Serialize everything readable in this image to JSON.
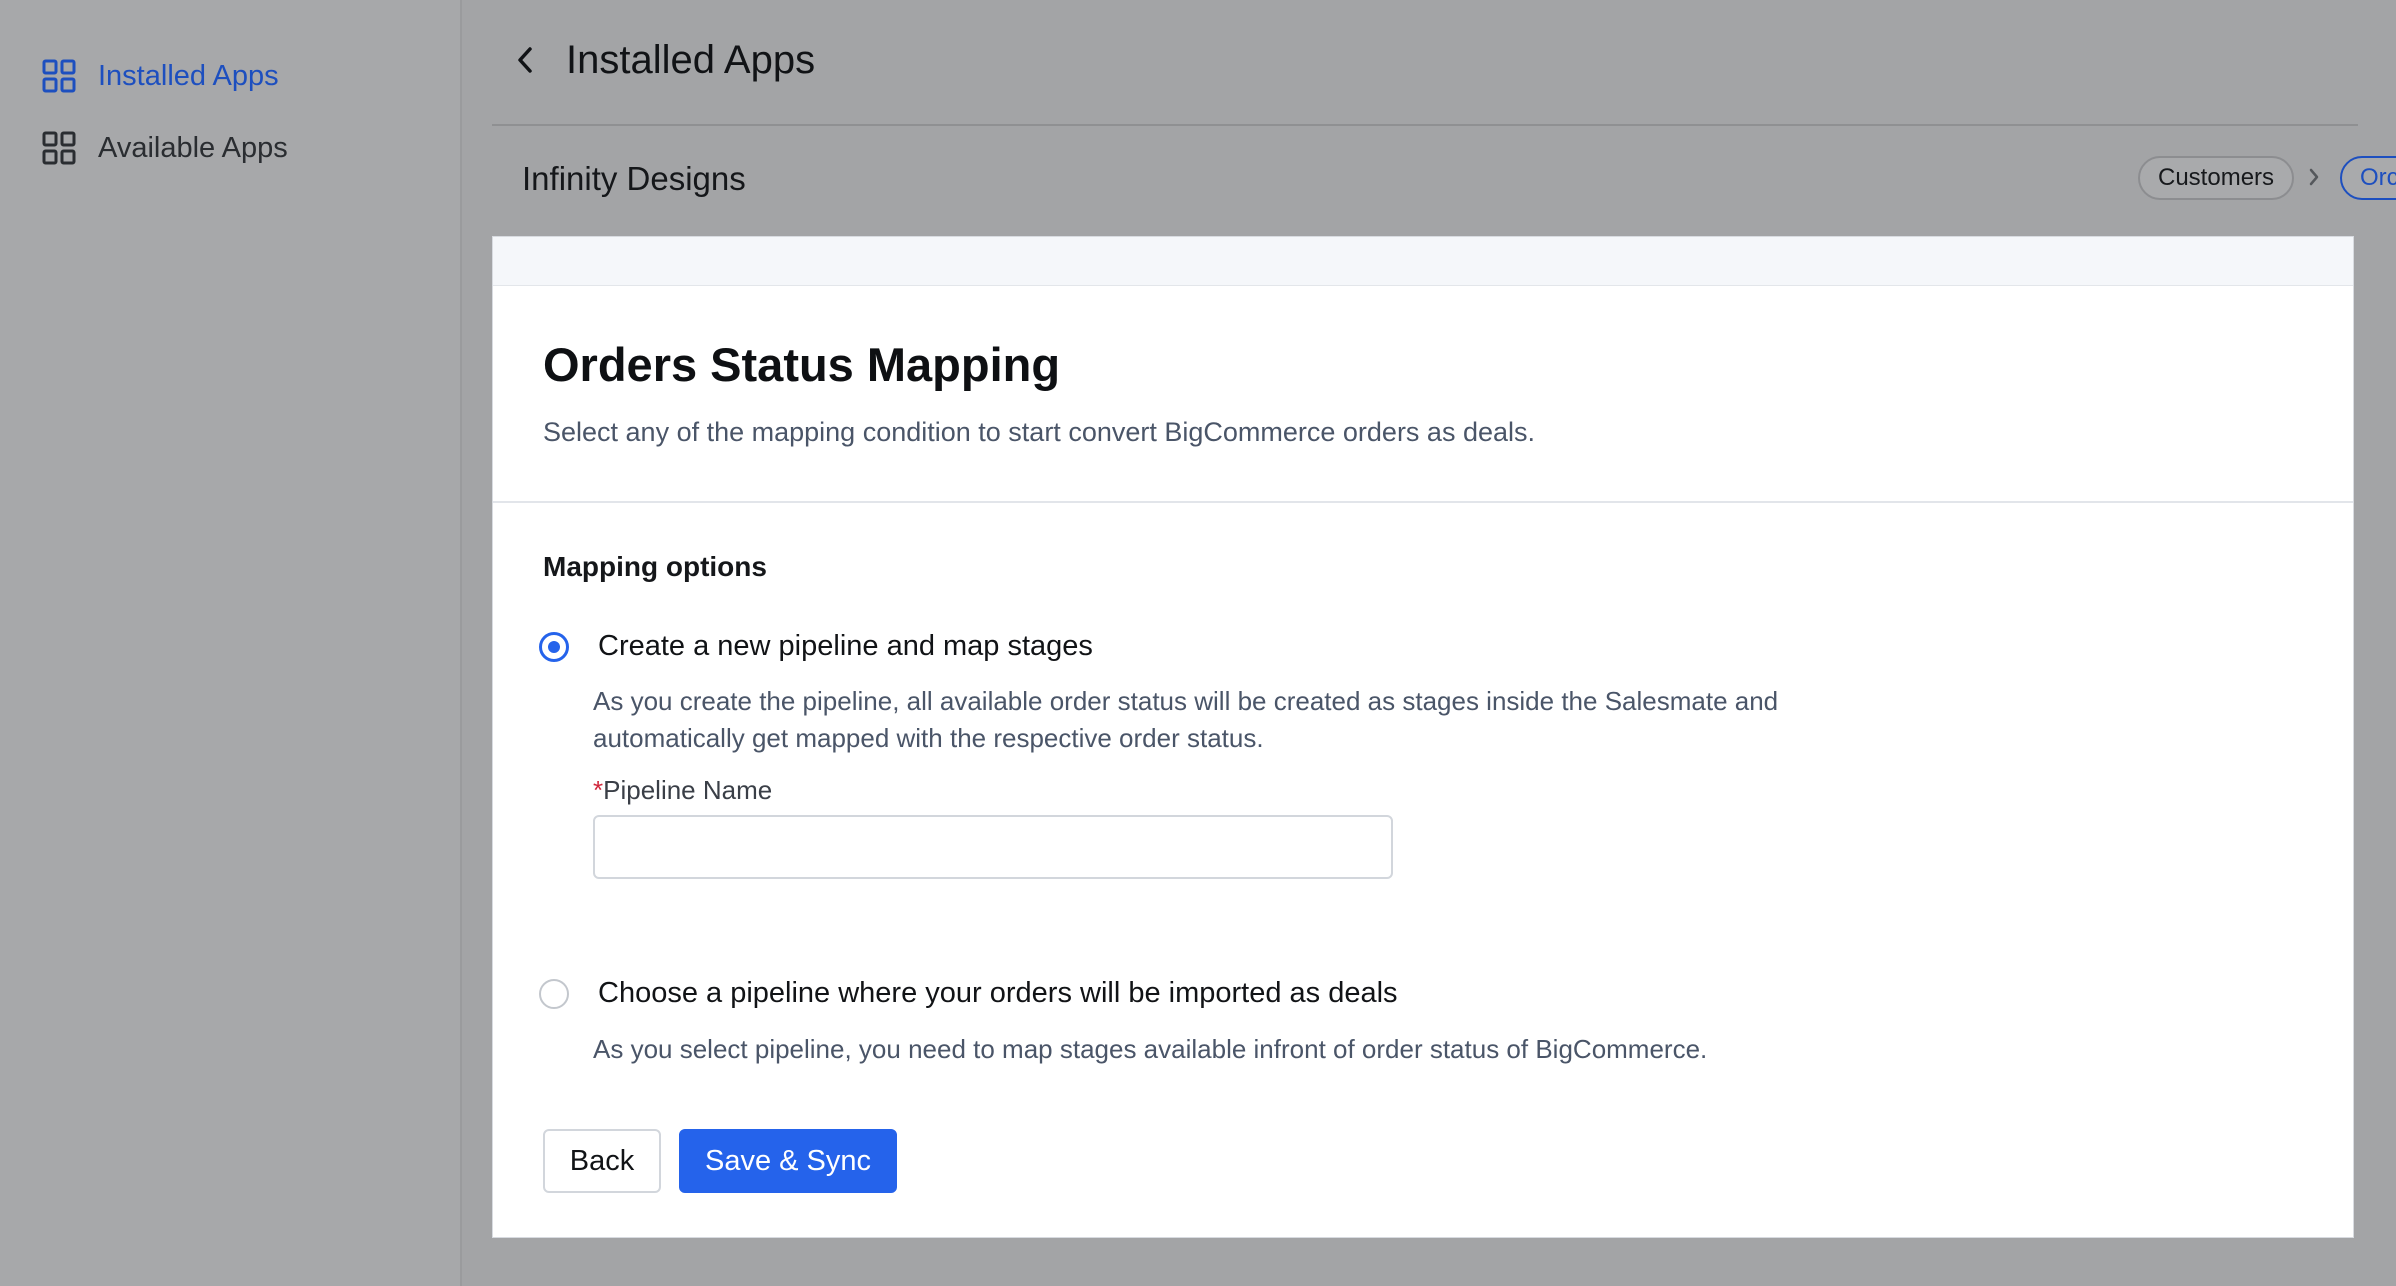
{
  "sidebar": {
    "items": [
      {
        "label": "Installed Apps",
        "icon": "grid-icon",
        "active": true
      },
      {
        "label": "Available Apps",
        "icon": "grid-icon",
        "active": false
      }
    ]
  },
  "header": {
    "back_icon": "chevron-left-icon",
    "title": "Installed Apps"
  },
  "subheader": {
    "company": "Infinity Designs",
    "breadcrumbs": [
      "Customers",
      "Orc"
    ],
    "separator_icon": "chevron-right-icon"
  },
  "card": {
    "title": "Orders Status Mapping",
    "subtitle": "Select any of the mapping condition to start convert BigCommerce orders as deals.",
    "section_label": "Mapping options",
    "options": [
      {
        "label": "Create a new pipeline and map stages",
        "description": "As you create the pipeline, all available order status will be created as stages inside the Salesmate and automatically get mapped with the respective order status.",
        "selected": true
      },
      {
        "label": "Choose a pipeline where your orders will be imported as deals",
        "description": "As you select pipeline, you need to map stages available infront of order status of BigCommerce.",
        "selected": false
      }
    ],
    "pipeline_field": {
      "required_mark": "*",
      "label": "Pipeline Name",
      "value": "",
      "placeholder": ""
    },
    "buttons": {
      "back": "Back",
      "save": "Save & Sync"
    }
  },
  "colors": {
    "accent": "#2563eb",
    "active_nav": "#1d4fbf",
    "required": "#d0263b",
    "overlay_background": "#a3a4a6"
  }
}
